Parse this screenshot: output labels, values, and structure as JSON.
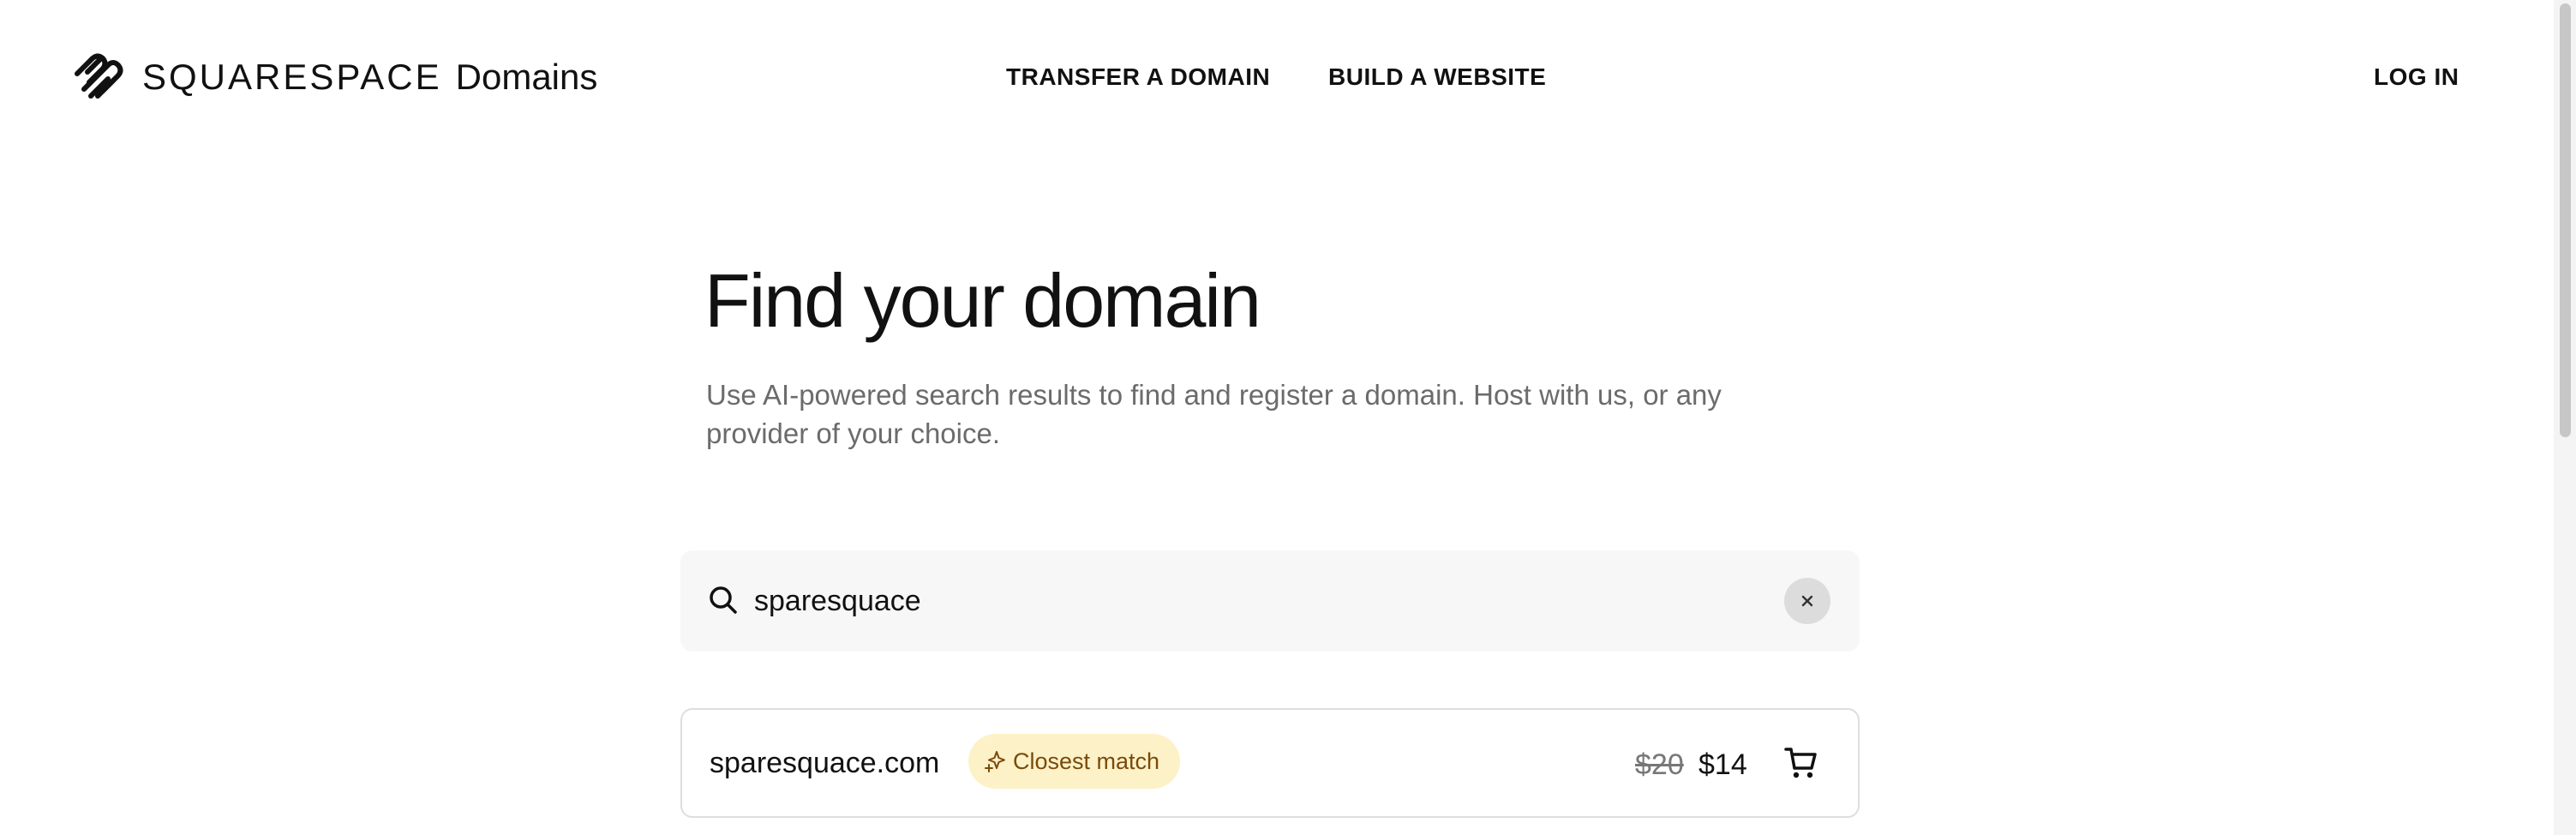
{
  "header": {
    "brand": "SQUARESPACE",
    "product": "Domains",
    "nav": {
      "transfer": "TRANSFER A DOMAIN",
      "build": "BUILD A WEBSITE",
      "login": "LOG IN"
    }
  },
  "hero": {
    "title": "Find your domain",
    "description": "Use AI-powered search results to find and register a domain. Host with us, or any provider of your choice."
  },
  "search": {
    "value": "sparesquace",
    "icon": "search-icon",
    "clear_icon": "close-icon"
  },
  "results": [
    {
      "domain": "sparesquace.com",
      "badge": "Closest match",
      "old_price": "$20",
      "price": "$14",
      "action_icon": "cart-icon"
    }
  ],
  "colors": {
    "badge_bg": "#fdf1c7",
    "badge_text": "#7a4a0c",
    "search_bg": "#f7f7f7",
    "muted_text": "#6b6b6b"
  }
}
